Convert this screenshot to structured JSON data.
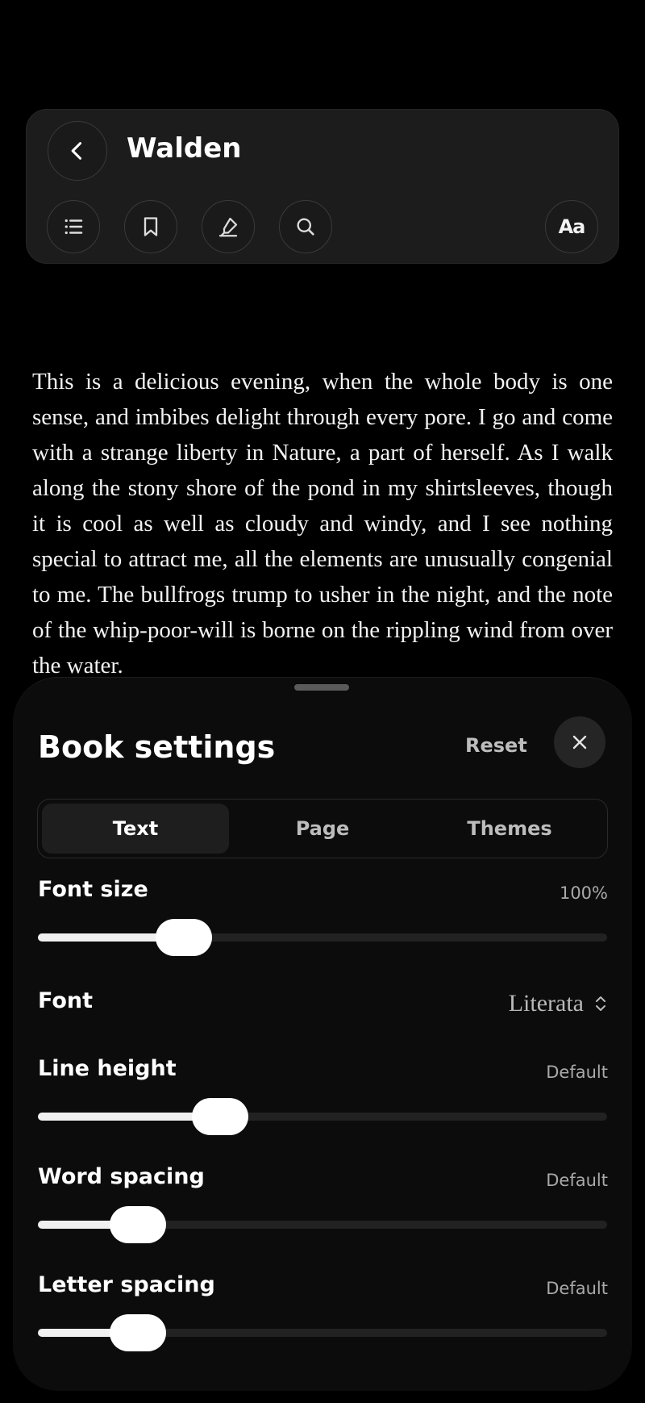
{
  "header": {
    "title": "Walden",
    "back_icon": "chevron-left-icon",
    "tools": [
      {
        "name": "toc",
        "icon": "list-icon"
      },
      {
        "name": "bookmark",
        "icon": "bookmark-icon"
      },
      {
        "name": "highlight",
        "icon": "highlighter-icon"
      },
      {
        "name": "search",
        "icon": "search-icon"
      }
    ],
    "text_settings_label": "Aa"
  },
  "reading": {
    "text": "This is a delicious evening, when the whole body is one sense, and imbibes delight through every pore. I go and come with a strange liberty in Nature, a part of herself. As I walk along the stony shore of the pond in my shirtsleeves, though it is cool as well as cloudy and windy, and I see nothing special to attract me, all the elements are unusually congenial to me. The bullfrogs trump to usher in the night, and the note of the whip-poor-will is borne on the rippling wind from over the water."
  },
  "sheet": {
    "title": "Book settings",
    "reset_label": "Reset",
    "close_icon": "close-icon",
    "tabs": [
      {
        "label": "Text",
        "active": true
      },
      {
        "label": "Page",
        "active": false
      },
      {
        "label": "Themes",
        "active": false
      }
    ],
    "font_size": {
      "label": "Font size",
      "value": "100%",
      "level": 0.23
    },
    "font": {
      "label": "Font",
      "value": "Literata"
    },
    "line_height": {
      "label": "Line height",
      "value": "Default",
      "level": 0.3
    },
    "word_spacing": {
      "label": "Word spacing",
      "value": "Default",
      "level": 0.14
    },
    "letter_spacing": {
      "label": "Letter spacing",
      "value": "Default",
      "level": 0.14
    }
  },
  "colors": {
    "background": "#000000",
    "sheet": "#0c0c0c",
    "toolbar": "#1c1c1c",
    "accent": "#ffffff"
  }
}
